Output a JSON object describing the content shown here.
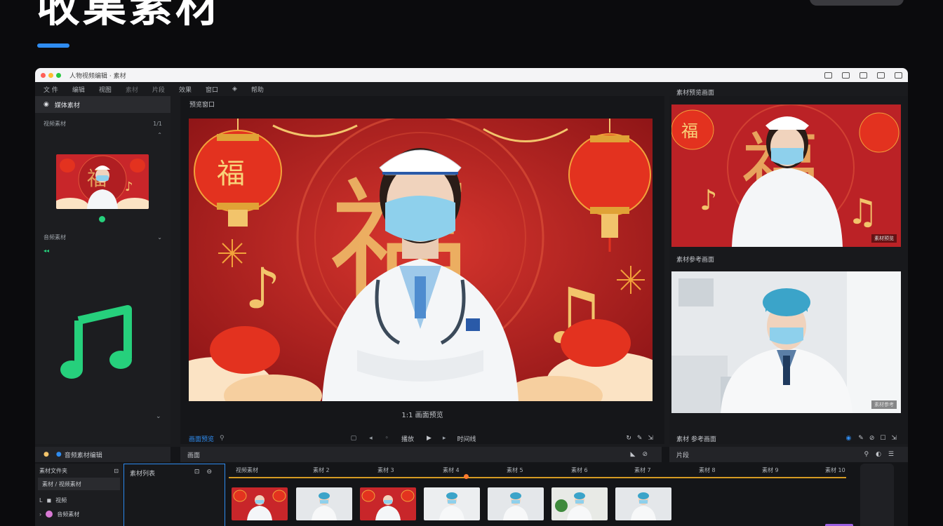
{
  "page": {
    "hero_title": "收集素材"
  },
  "window": {
    "title": "人物视频编辑 · 素材"
  },
  "menu": [
    "文 件",
    "编辑",
    "视图",
    "素材",
    "片段",
    "效果",
    "窗口",
    "帮助"
  ],
  "left_panel": {
    "header": "媒体素材",
    "section1_label": "视频素材",
    "section1_count": "1/1",
    "section2_label": "音频素材"
  },
  "center_panel": {
    "title": "预览窗口",
    "caption": "1:1 画面预览",
    "tab_label": "画面预览",
    "controls_center": "播放",
    "controls_right": "时间线"
  },
  "right_panel": {
    "title1": "素材预览画面",
    "title2": "素材参考画面",
    "badge1": "素材预览",
    "badge2": "素材参考",
    "footer_label": "素材 参考画面"
  },
  "bottom": {
    "left_tab": "音频素材编辑",
    "tree_header": "素材文件夹",
    "tree_sub": "素材 / 视频素材",
    "tree_item1": "视频",
    "tree_item2": "音频素材",
    "middle_tab": "素材列表",
    "center_bar_label": "画面",
    "right_bar_label": "片段",
    "clip_labels": [
      "视频素材",
      "素材 2",
      "素材 3",
      "素材 4",
      "素材 5",
      "素材 6",
      "素材 7",
      "素材 8",
      "素材 9",
      "素材 10"
    ]
  },
  "colors": {
    "accent_blue": "#2f8cf0",
    "accent_green": "#26d07c",
    "festive_red": "#c8262a",
    "gold": "#f2c46b",
    "playline": "#d49a23"
  }
}
